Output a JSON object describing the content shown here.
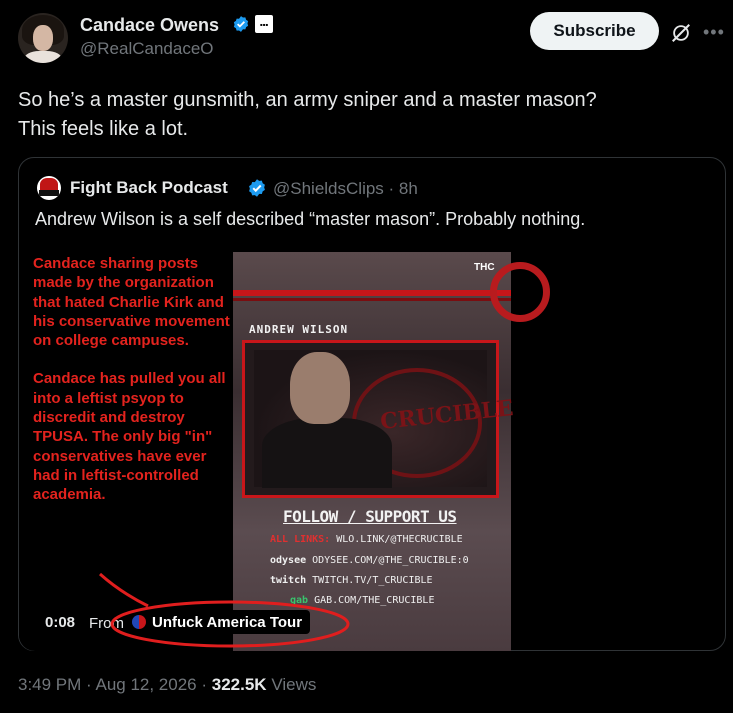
{
  "header": {
    "author_name": "Candace Owens",
    "author_handle": "@RealCandaceO",
    "subscribe_label": "Subscribe",
    "more_icon": "more-icon",
    "grok_icon": "grok-icon"
  },
  "tweet": {
    "line1": "So he’s a master gunsmith, an army sniper and a master mason?",
    "line2": "This feels like a lot."
  },
  "quote": {
    "author_name": "Fight Back Podcast",
    "author_handle": "@ShieldsClips",
    "age": "· 8h",
    "text": "Andrew Wilson is a self described “master mason”. Probably nothing."
  },
  "overlay": {
    "paragraph1": "Candace sharing posts made by the organization that hated Charlie Kirk and his conservative movement on college campuses.",
    "paragraph2": "Candace has pulled you all into a leftist psyop to discredit and destroy TPUSA. The only big \"in\" conservatives have ever had in leftist-controlled academia."
  },
  "video": {
    "logo_text": "THC",
    "name_label": "ANDREW WILSON",
    "crucible_text": "CRUCIBLE",
    "follow_label": "FOLLOW / SUPPORT US",
    "links": [
      {
        "label": "ALL LINKS:",
        "value": "WLO.LINK/@THECRUCIBLE"
      },
      {
        "label": "odysee",
        "value": "ODYSEE.COM/@THE_CRUCIBLE:0"
      },
      {
        "label": "twitch",
        "value": "TWITCH.TV/T_CRUCIBLE"
      },
      {
        "label": "gab",
        "value": "GAB.COM/THE_CRUCIBLE"
      }
    ],
    "elapsed": "0:08",
    "from_label": "From",
    "source_label": "Unfuck America Tour"
  },
  "footer": {
    "time": "3:49 PM",
    "date": "Aug 12, 2026",
    "views_count": "322.5K",
    "views_label": "Views"
  },
  "colors": {
    "background": "#000000",
    "verified_blue": "#1d9bf0",
    "overlay_red": "#e3231e",
    "annotation_red": "#e01e1e"
  }
}
